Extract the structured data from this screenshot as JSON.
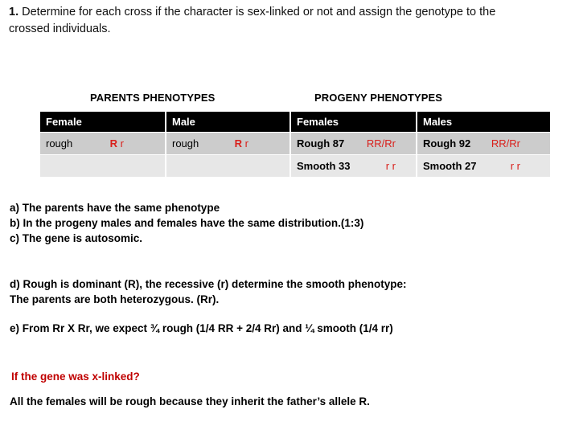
{
  "question": {
    "number": "1.",
    "text": "Determine for each cross if the character is sex-linked or not and assign the genotype to the crossed individuals."
  },
  "captions": {
    "parents": "PARENTS PHENOTYPES",
    "progeny": "PROGENY PHENOTYPES"
  },
  "table": {
    "headers": [
      "Female",
      "Male",
      "Females",
      "Males"
    ],
    "rows": [
      {
        "parents_female": {
          "phenotype": "rough",
          "dominant": "R",
          "recessive": " r"
        },
        "parents_male": {
          "phenotype": "rough",
          "dominant": "R",
          "recessive": " r"
        },
        "progeny_females": {
          "phenotype": "Rough 87",
          "genotype": "RR/Rr"
        },
        "progeny_males": {
          "phenotype": "Rough 92",
          "genotype": "RR/Rr"
        }
      },
      {
        "parents_female": {
          "phenotype": "",
          "dominant": "",
          "recessive": ""
        },
        "parents_male": {
          "phenotype": "",
          "dominant": "",
          "recessive": ""
        },
        "progeny_females": {
          "phenotype": "Smooth 33",
          "genotype": "r r"
        },
        "progeny_males": {
          "phenotype": "Smooth 27",
          "genotype": "r r"
        }
      }
    ]
  },
  "answers": {
    "a": "a) The parents have the same phenotype",
    "b": "b) In the progeny males and females have the same distribution.(1:3)",
    "c": "c) The gene is autosomic.",
    "d_line1": "d) Rough is dominant (R), the recessive (r) determine the smooth phenotype:",
    "d_line2": "The parents are both heterozygous. (Rr).",
    "e": "e) From Rr X Rr, we expect ¾ rough (1/4 RR + 2/4 Rr) and ¼ smooth (1/4 rr)"
  },
  "xlinked": {
    "question": "If the gene was x-linked?",
    "answer": "All the females will be rough because they inherit the father’s allele R."
  },
  "colors": {
    "genotype_red": "#d9211c",
    "heading_red": "#c00000",
    "header_bg": "#000000",
    "row_a_bg": "#cccccc",
    "row_b_bg": "#e7e7e7"
  }
}
